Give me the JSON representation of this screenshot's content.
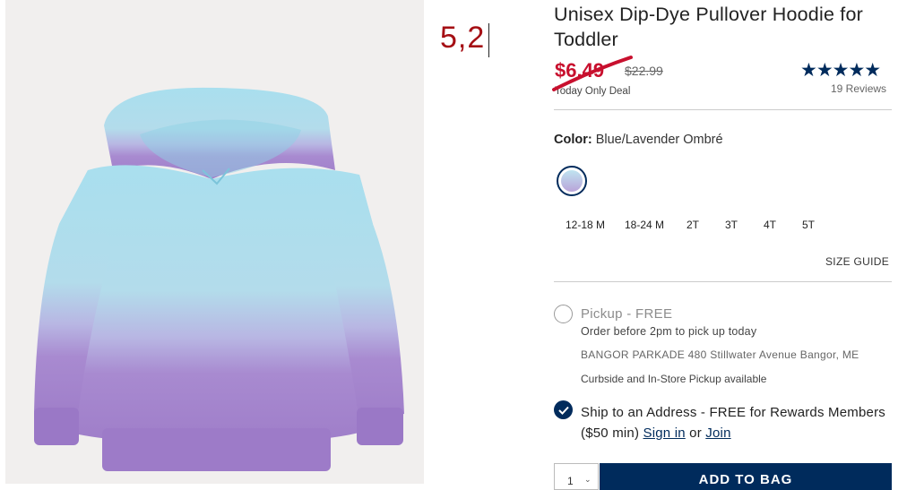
{
  "product": {
    "title": "Unisex Dip-Dye Pullover Hoodie for Toddler",
    "sale_price": "$6.49",
    "original_price": "$22.99",
    "deal_text": "Today Only Deal",
    "stars": "★★★★★",
    "reviews": "19 Reviews"
  },
  "annotation": {
    "note": "5,2"
  },
  "color": {
    "label": "Color:",
    "value": "Blue/Lavender Ombré",
    "swatch_top": "#bfe4f0",
    "swatch_bottom": "#b9a3d9"
  },
  "sizes": [
    "12-18 M",
    "18-24 M",
    "2T",
    "3T",
    "4T",
    "5T"
  ],
  "size_guide": "SIZE GUIDE",
  "fulfillment": {
    "pickup_label": "Pickup - FREE",
    "pickup_sub": "Order before 2pm to pick up today",
    "store": "BANGOR PARKADE 480 Stillwater Avenue  Bangor, ME",
    "curbside": "Curbside and In-Store Pickup available",
    "ship_text": "Ship to an Address - FREE for Rewards Members ($50 min)",
    "sign_in": "Sign in",
    "or": "or",
    "join": "Join"
  },
  "cart": {
    "qty": "1",
    "add_label": "ADD TO BAG"
  },
  "colors": {
    "brand_navy": "#002b5c",
    "sale_red": "#c8102e"
  }
}
